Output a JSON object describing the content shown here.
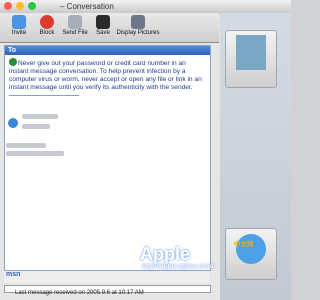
{
  "window": {
    "title": "– Conversation"
  },
  "toolbar": {
    "items": [
      {
        "label": "Invite",
        "icon": "invite-icon"
      },
      {
        "label": "Block",
        "icon": "block-icon"
      },
      {
        "label": "Send File",
        "icon": "send-file-icon"
      },
      {
        "label": "Save",
        "icon": "save-icon"
      },
      {
        "label": "Display Pictures",
        "icon": "display-pictures-icon"
      }
    ]
  },
  "chat": {
    "to_label": "To",
    "warning": "Never give out your password or credit card number in an instant message conversation. To help prevent infection by a computer virus or worm, never accept or open any file or link in an instant message until you verify its authenticity with the sender."
  },
  "compose": {
    "logo": "msn"
  },
  "status": {
    "text": "Last message received on 2005.9.6 at 10:17 AM"
  },
  "watermark": {
    "brand": "Apple",
    "url": "http://apple.tgbus.com/",
    "cn": "中文网"
  },
  "colors": {
    "accent": "#2f63b8",
    "warning_text": "#1b3f8f"
  }
}
